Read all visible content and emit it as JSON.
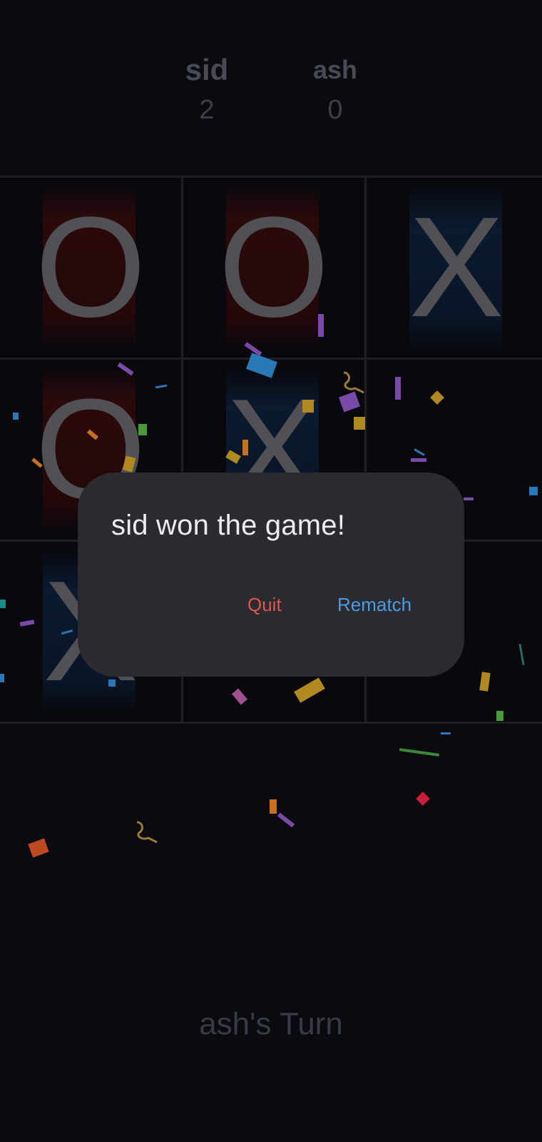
{
  "scoreboard": {
    "player1": {
      "name": "sid",
      "score": "2"
    },
    "player2": {
      "name": "ash",
      "score": "0"
    }
  },
  "board": {
    "cells": [
      {
        "mark": "O"
      },
      {
        "mark": "O"
      },
      {
        "mark": "X"
      },
      {
        "mark": "O"
      },
      {
        "mark": "X"
      },
      {
        "mark": ""
      },
      {
        "mark": "X"
      },
      {
        "mark": ""
      },
      {
        "mark": ""
      }
    ],
    "colors": {
      "o_glow": "#370a0a",
      "x_glow": "#0c1e37",
      "mark": "#505055"
    }
  },
  "dialog": {
    "message": "sid won the game!",
    "quit_label": "Quit",
    "rematch_label": "Rematch"
  },
  "turn_text": "ash's Turn",
  "colors": {
    "background": "#0a0a10",
    "dialog_bg": "#2a2a30",
    "quit": "#e2554a",
    "rematch": "#4a9be0"
  }
}
